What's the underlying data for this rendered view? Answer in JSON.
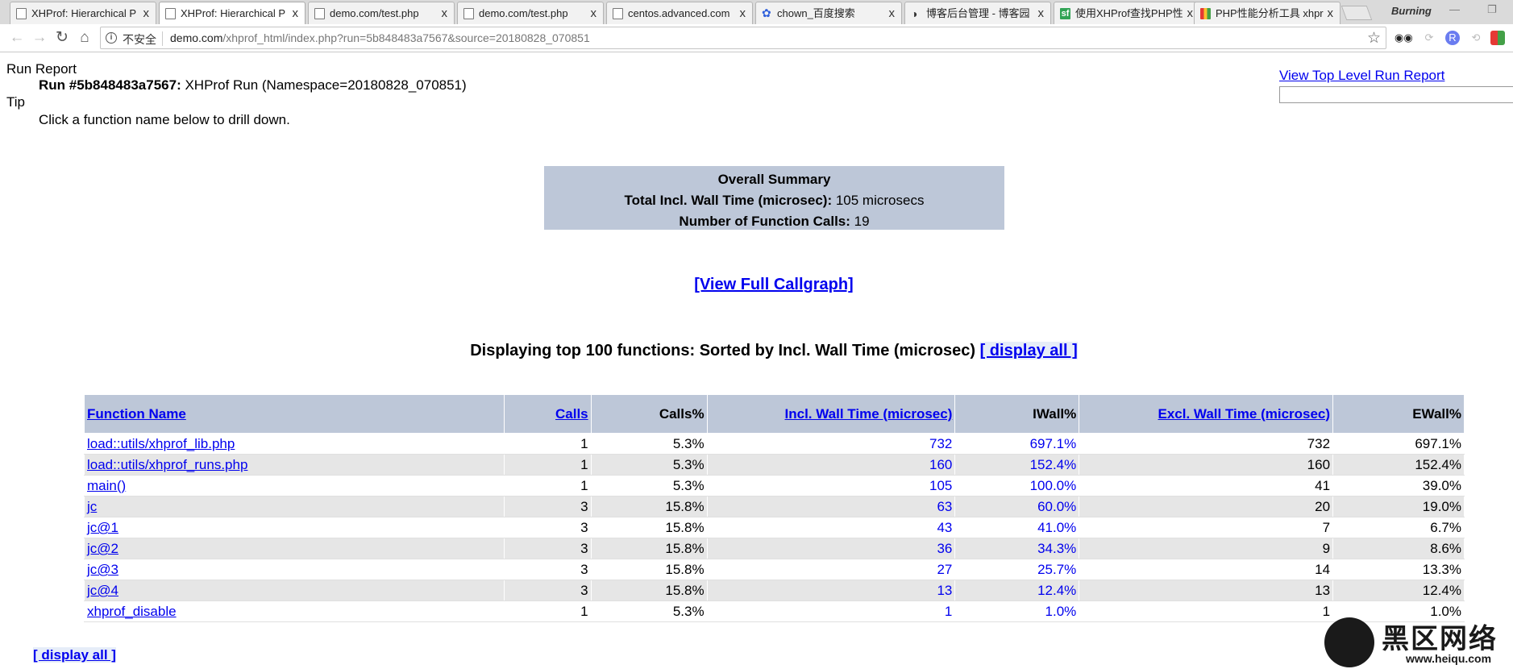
{
  "browser": {
    "tabs": [
      {
        "title": "XHProf: Hierarchical P",
        "icon": "page-icon",
        "active": false
      },
      {
        "title": "XHProf: Hierarchical P",
        "icon": "page-icon",
        "active": true
      },
      {
        "title": "demo.com/test.php",
        "icon": "page-icon",
        "active": false
      },
      {
        "title": "demo.com/test.php",
        "icon": "page-icon",
        "active": false
      },
      {
        "title": "centos.advanced.com",
        "icon": "page-icon",
        "active": false
      },
      {
        "title": "chown_百度搜索",
        "icon": "baidu-icon",
        "active": false
      },
      {
        "title": "博客后台管理 - 博客园",
        "icon": "cnblogs-icon",
        "active": false
      },
      {
        "title": "使用XHProf查找PHP性",
        "icon": "segmentfault-icon",
        "active": false
      },
      {
        "title": "PHP性能分析工具 xhpr",
        "icon": "multicolor-icon",
        "active": false
      }
    ],
    "close_glyph": "x",
    "user_name": "Burning",
    "address": {
      "insecure_label": "不安全",
      "host": "demo.com",
      "path": "/xhprof_html/index.php?run=5b848483a7567&source=20180828_070851"
    }
  },
  "page": {
    "run_report_label": "Run Report",
    "run_id_label": "Run #5b848483a7567:",
    "run_desc": "XHProf Run (Namespace=20180828_070851)",
    "tip_label": "Tip",
    "tip_text": "Click a function name below to drill down.",
    "top_level_link": "View Top Level Run Report",
    "summary": {
      "title": "Overall Summary",
      "wall_label": "Total Incl. Wall Time (microsec):",
      "wall_value": "105 microsecs",
      "calls_label": "Number of Function Calls:",
      "calls_value": "19"
    },
    "callgraph_link": "[View Full Callgraph]",
    "displaying_text": "Displaying top 100 functions: Sorted by Incl. Wall Time (microsec)",
    "display_all_link": "[ display all ]",
    "bottom_display_all": "[ display all ]"
  },
  "table": {
    "headers": {
      "function_name": "Function Name",
      "calls": "Calls",
      "calls_pct": "Calls%",
      "incl_wall": "Incl. Wall Time (microsec)",
      "iwall_pct": "IWall%",
      "excl_wall": "Excl. Wall Time (microsec)",
      "ewall_pct": "EWall%"
    },
    "rows": [
      {
        "name": "load::utils/xhprof_lib.php",
        "calls": "1",
        "calls_pct": "5.3%",
        "incl": "732",
        "iwall": "697.1%",
        "excl": "732",
        "ewall": "697.1%"
      },
      {
        "name": "load::utils/xhprof_runs.php",
        "calls": "1",
        "calls_pct": "5.3%",
        "incl": "160",
        "iwall": "152.4%",
        "excl": "160",
        "ewall": "152.4%"
      },
      {
        "name": "main()",
        "calls": "1",
        "calls_pct": "5.3%",
        "incl": "105",
        "iwall": "100.0%",
        "excl": "41",
        "ewall": "39.0%"
      },
      {
        "name": "jc",
        "calls": "3",
        "calls_pct": "15.8%",
        "incl": "63",
        "iwall": "60.0%",
        "excl": "20",
        "ewall": "19.0%"
      },
      {
        "name": "jc@1",
        "calls": "3",
        "calls_pct": "15.8%",
        "incl": "43",
        "iwall": "41.0%",
        "excl": "7",
        "ewall": "6.7%"
      },
      {
        "name": "jc@2",
        "calls": "3",
        "calls_pct": "15.8%",
        "incl": "36",
        "iwall": "34.3%",
        "excl": "9",
        "ewall": "8.6%"
      },
      {
        "name": "jc@3",
        "calls": "3",
        "calls_pct": "15.8%",
        "incl": "27",
        "iwall": "25.7%",
        "excl": "14",
        "ewall": "13.3%"
      },
      {
        "name": "jc@4",
        "calls": "3",
        "calls_pct": "15.8%",
        "incl": "13",
        "iwall": "12.4%",
        "excl": "13",
        "ewall": "12.4%"
      },
      {
        "name": "xhprof_disable",
        "calls": "1",
        "calls_pct": "5.3%",
        "incl": "1",
        "iwall": "1.0%",
        "excl": "1",
        "ewall": "1.0%"
      }
    ]
  },
  "watermark": {
    "text": "黑区网络",
    "url": "www.heiqu.com"
  },
  "colors": {
    "header_bg": "#bdc7d8",
    "link": "#0000ee",
    "row_alt": "#e6e6e6"
  }
}
